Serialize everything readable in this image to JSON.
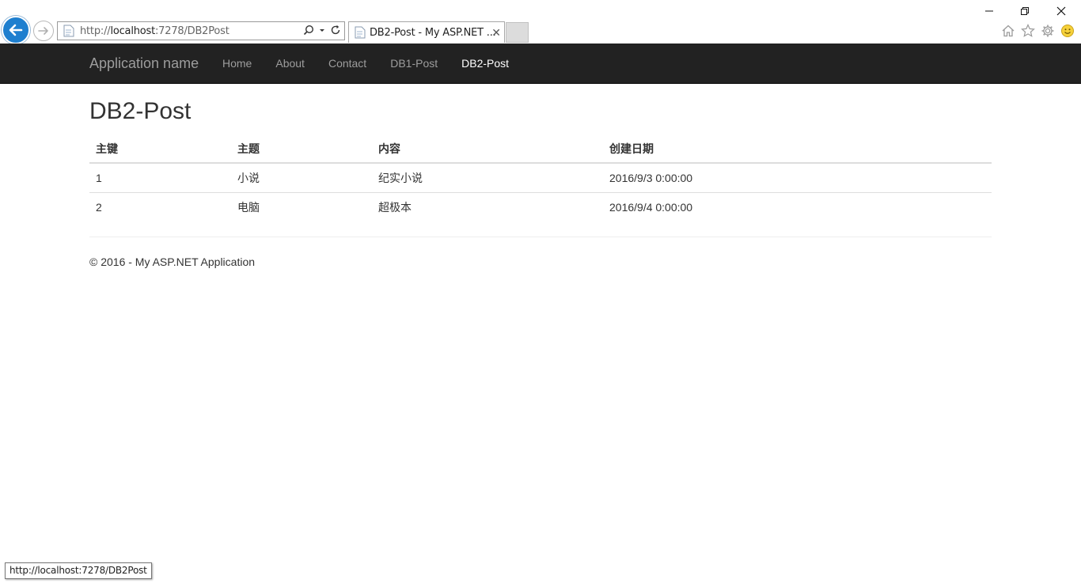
{
  "browser": {
    "address_scheme": "http://",
    "address_host": "localhost",
    "address_rest": ":7278/DB2Post",
    "tab_title": "DB2-Post - My ASP.NET ...",
    "status_url": "http://localhost:7278/DB2Post",
    "accent": "#1e7fcf",
    "icons": [
      "back-arrow-icon",
      "forward-arrow-icon",
      "page-icon",
      "search-icon",
      "dropdown-icon",
      "refresh-icon",
      "close-icon",
      "home-icon",
      "star-icon",
      "gear-icon",
      "smiley-icon",
      "minimize-icon",
      "restore-icon",
      "window-close-icon"
    ]
  },
  "navbar": {
    "brand": "Application name",
    "items": [
      {
        "label": "Home"
      },
      {
        "label": "About"
      },
      {
        "label": "Contact"
      },
      {
        "label": "DB1-Post"
      },
      {
        "label": "DB2-Post"
      }
    ],
    "active": "DB2-Post",
    "background": "#222222"
  },
  "main": {
    "title": "DB2-Post",
    "table": {
      "headers": [
        "主键",
        "主题",
        "内容",
        "创建日期"
      ],
      "rows": [
        [
          "1",
          "小说",
          "纪实小说",
          "2016/9/3 0:00:00"
        ],
        [
          "2",
          "电脑",
          "超极本",
          "2016/9/4 0:00:00"
        ]
      ]
    }
  },
  "footer": {
    "text": "© 2016 - My ASP.NET Application"
  }
}
